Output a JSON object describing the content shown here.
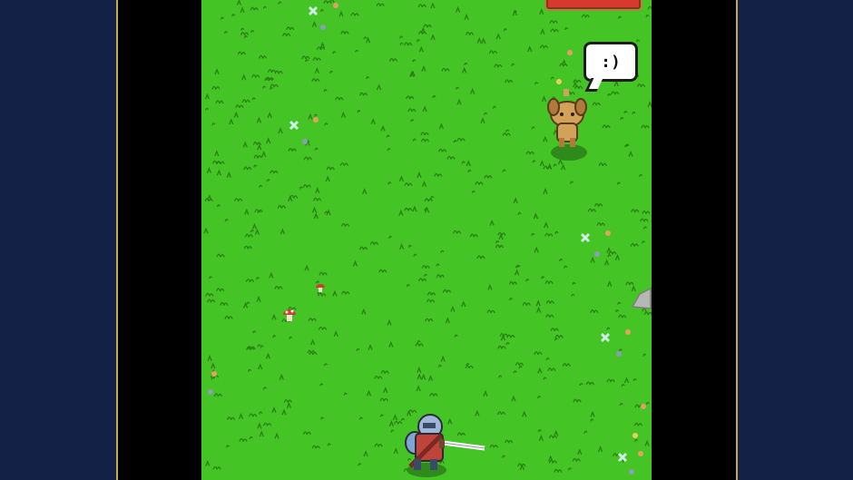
{
  "colors": {
    "background": "#132147",
    "grass": "#45c426",
    "grass_tuft": "#2a7f14",
    "health_bar": "#d8382e",
    "frame_border": "#c9a94a"
  },
  "npc": {
    "name_icon": "dog-icon",
    "speech": ":)"
  },
  "player": {
    "icon": "knight-with-sword-icon"
  },
  "hud": {
    "health_bar_icon": "health-bar"
  }
}
